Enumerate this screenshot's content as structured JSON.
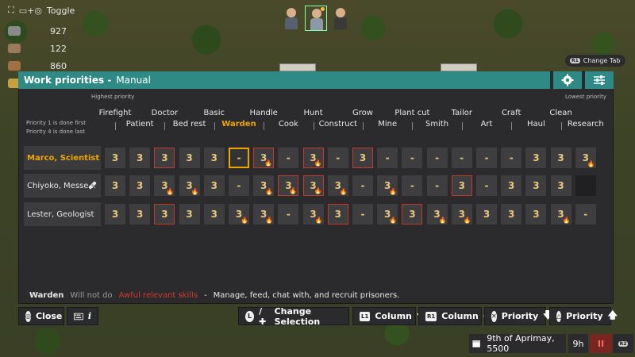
{
  "hud": {
    "toggle_label": "Toggle",
    "toggle_glyph_a": "⛶",
    "toggle_glyph_b": "▭+◎",
    "resources": [
      {
        "icon": "stone-icon",
        "color": "#8a8a8a",
        "value": "927"
      },
      {
        "icon": "metal-icon",
        "color": "#9a7a5a",
        "value": "122"
      },
      {
        "icon": "wood-icon",
        "color": "#a07040",
        "value": "860"
      },
      {
        "icon": "cloth-icon",
        "color": "#c8a040",
        "value": ""
      }
    ]
  },
  "colonist_bar": {
    "colonists": [
      {
        "name": "portrait-1",
        "body_color": "#556070"
      },
      {
        "name": "portrait-2",
        "body_color": "#8a9aa8"
      },
      {
        "name": "portrait-3",
        "body_color": "#3a3a3a"
      }
    ]
  },
  "change_tab": {
    "label": "Change Tab",
    "badge": "R1"
  },
  "panel": {
    "title": "Work priorities -",
    "mode": "Manual",
    "highest_priority": "Highest priority",
    "lowest_priority": "Lowest priority",
    "note1": "Priority 1 is done first",
    "note2": "Priority 4 is done last",
    "columns_top": [
      "Firefight",
      "Doctor",
      "Basic",
      "Handle",
      "Hunt",
      "Grow",
      "Plant cut",
      "Tailor",
      "Craft",
      "Clean"
    ],
    "columns_bottom": [
      "Patient",
      "Bed rest",
      "Warden",
      "Cook",
      "Construct",
      "Mine",
      "Smith",
      "Art",
      "Haul",
      "Research"
    ],
    "active_column": "Warden",
    "rows": [
      {
        "name": "Marco, Scientist",
        "selected": true,
        "cells": [
          {
            "v": "3"
          },
          {
            "v": "3"
          },
          {
            "v": "3",
            "red": true
          },
          {
            "v": "3"
          },
          {
            "v": "3"
          },
          {
            "v": "-",
            "sel": true
          },
          {
            "v": "3",
            "flame": true,
            "red": true
          },
          {
            "v": "-"
          },
          {
            "v": "3",
            "flame": true,
            "red": true
          },
          {
            "v": "-"
          },
          {
            "v": "3",
            "red": true
          },
          {
            "v": "-"
          },
          {
            "v": "-"
          },
          {
            "v": "-"
          },
          {
            "v": "-"
          },
          {
            "v": "-"
          },
          {
            "v": "-"
          },
          {
            "v": "3"
          },
          {
            "v": "3"
          },
          {
            "v": "3",
            "flame": true
          }
        ]
      },
      {
        "name": "Chiyoko, Messe...",
        "selected": false,
        "tool": true,
        "cells": [
          {
            "v": "3"
          },
          {
            "v": "3"
          },
          {
            "v": "3",
            "flame": true
          },
          {
            "v": "3",
            "flame": true
          },
          {
            "v": "3"
          },
          {
            "v": "-"
          },
          {
            "v": "3",
            "flame": true
          },
          {
            "v": "3",
            "flame": true,
            "red": true
          },
          {
            "v": "3",
            "flame": true,
            "red": true
          },
          {
            "v": "3",
            "flame": true
          },
          {
            "v": "-"
          },
          {
            "v": "3",
            "flame": true
          },
          {
            "v": "-"
          },
          {
            "v": "-"
          },
          {
            "v": "3",
            "red": true
          },
          {
            "v": "-"
          },
          {
            "v": "3"
          },
          {
            "v": "3"
          },
          {
            "v": "3"
          },
          {
            "v": "",
            "empty": true
          }
        ]
      },
      {
        "name": "Lester, Geologist",
        "selected": false,
        "cells": [
          {
            "v": "3"
          },
          {
            "v": "3"
          },
          {
            "v": "3",
            "red": true
          },
          {
            "v": "3"
          },
          {
            "v": "3"
          },
          {
            "v": "3",
            "flame": true
          },
          {
            "v": "3",
            "flame": true
          },
          {
            "v": "-"
          },
          {
            "v": "3",
            "flame": true
          },
          {
            "v": "3",
            "red": true
          },
          {
            "v": "-"
          },
          {
            "v": "3",
            "flame": true
          },
          {
            "v": "3",
            "red": true
          },
          {
            "v": "3",
            "flame": true
          },
          {
            "v": "3",
            "flame": true
          },
          {
            "v": "3"
          },
          {
            "v": "3"
          },
          {
            "v": "3"
          },
          {
            "v": "3",
            "flame": true
          },
          {
            "v": "-"
          }
        ]
      }
    ],
    "description": {
      "job": "Warden",
      "will_not_do": "Will not do",
      "awful": "Awful relevant skills",
      "dash": "-",
      "text": "Manage, feed, chat with, and recruit prisoners."
    }
  },
  "bottom": {
    "close": "Close",
    "close_glyph": "◎",
    "info_glyph": "i",
    "change_selection": "Change Selection",
    "change_selection_glyph_a": "L",
    "change_selection_sep": "/ ✚",
    "column_down_badge": "L1",
    "column_down": "Column",
    "column_up_badge": "R1",
    "column_up": "Column",
    "priority_down_glyph": "✕",
    "priority_down": "Priority",
    "priority_up_glyph": "△",
    "priority_up": "Priority",
    "arrow_down": "🡇",
    "arrow_up": "🡅"
  },
  "time": {
    "date": "9th of Aprimay, 5500",
    "hour": "9h",
    "pause_glyph": "II",
    "speed_badge": "R2"
  }
}
